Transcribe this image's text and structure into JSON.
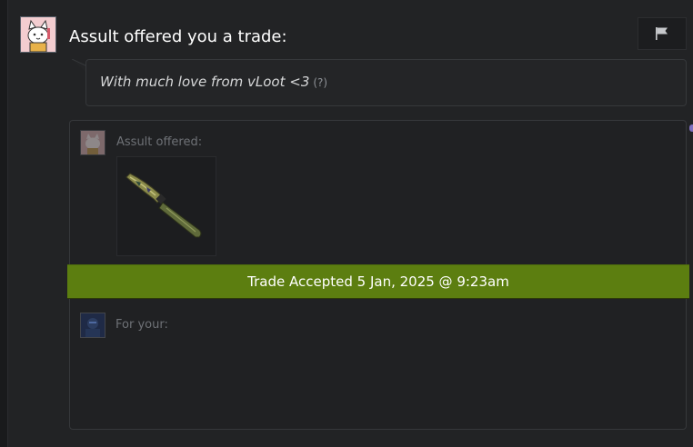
{
  "header": {
    "title": "Assult offered you a trade:"
  },
  "message": {
    "text": "With much love from vLoot <3",
    "help": "(?)"
  },
  "trade": {
    "offered_label": "Assult offered:",
    "your_label": "For your:",
    "status": "Trade Accepted 5 Jan, 2025 @ 9:23am"
  },
  "icons": {
    "flag": "flag-icon",
    "item": "knife-icon"
  },
  "colors": {
    "accepted_bar": "#5c7e10",
    "background": "#222325"
  }
}
